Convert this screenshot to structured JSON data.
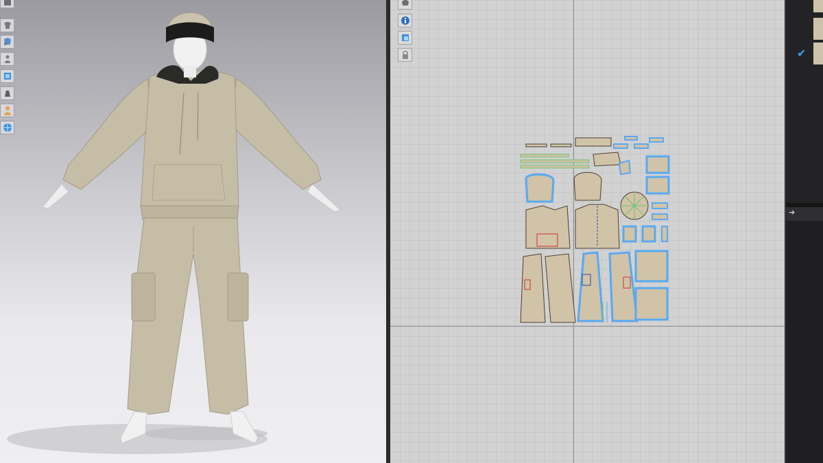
{
  "viewport_3d": {
    "toolbar": [
      {
        "name": "avatar-display-icon"
      },
      {
        "name": "show-garment-icon"
      },
      {
        "name": "show-pattern-icon"
      },
      {
        "name": "show-avatar-icon"
      },
      {
        "name": "texture-display-icon"
      },
      {
        "name": "fitting-suit-icon"
      },
      {
        "name": "skin-display-icon"
      },
      {
        "name": "environment-icon"
      }
    ],
    "colors": {
      "garment": "#c6bda7",
      "garment_shadow": "#a49b86",
      "hood_lining": "#2a2a26",
      "beanie": "#cbc3ad",
      "beanie_band": "#1c1c1c",
      "skin": "#f1f1f1"
    }
  },
  "viewport_2d": {
    "toolbar": [
      {
        "name": "2d-view-mode-icon"
      },
      {
        "name": "info-icon"
      },
      {
        "name": "pattern-display-icon"
      },
      {
        "name": "lock-icon"
      }
    ],
    "colors": {
      "piece_fill": "#d0c3a8",
      "piece_outline": "#4a4030",
      "selection": "#5aa9f0",
      "seam_green": "#6fc16e",
      "notch_red": "#d0302c"
    }
  },
  "right_panel": {
    "check_mark": "✔",
    "expand_arrow": "➔"
  }
}
